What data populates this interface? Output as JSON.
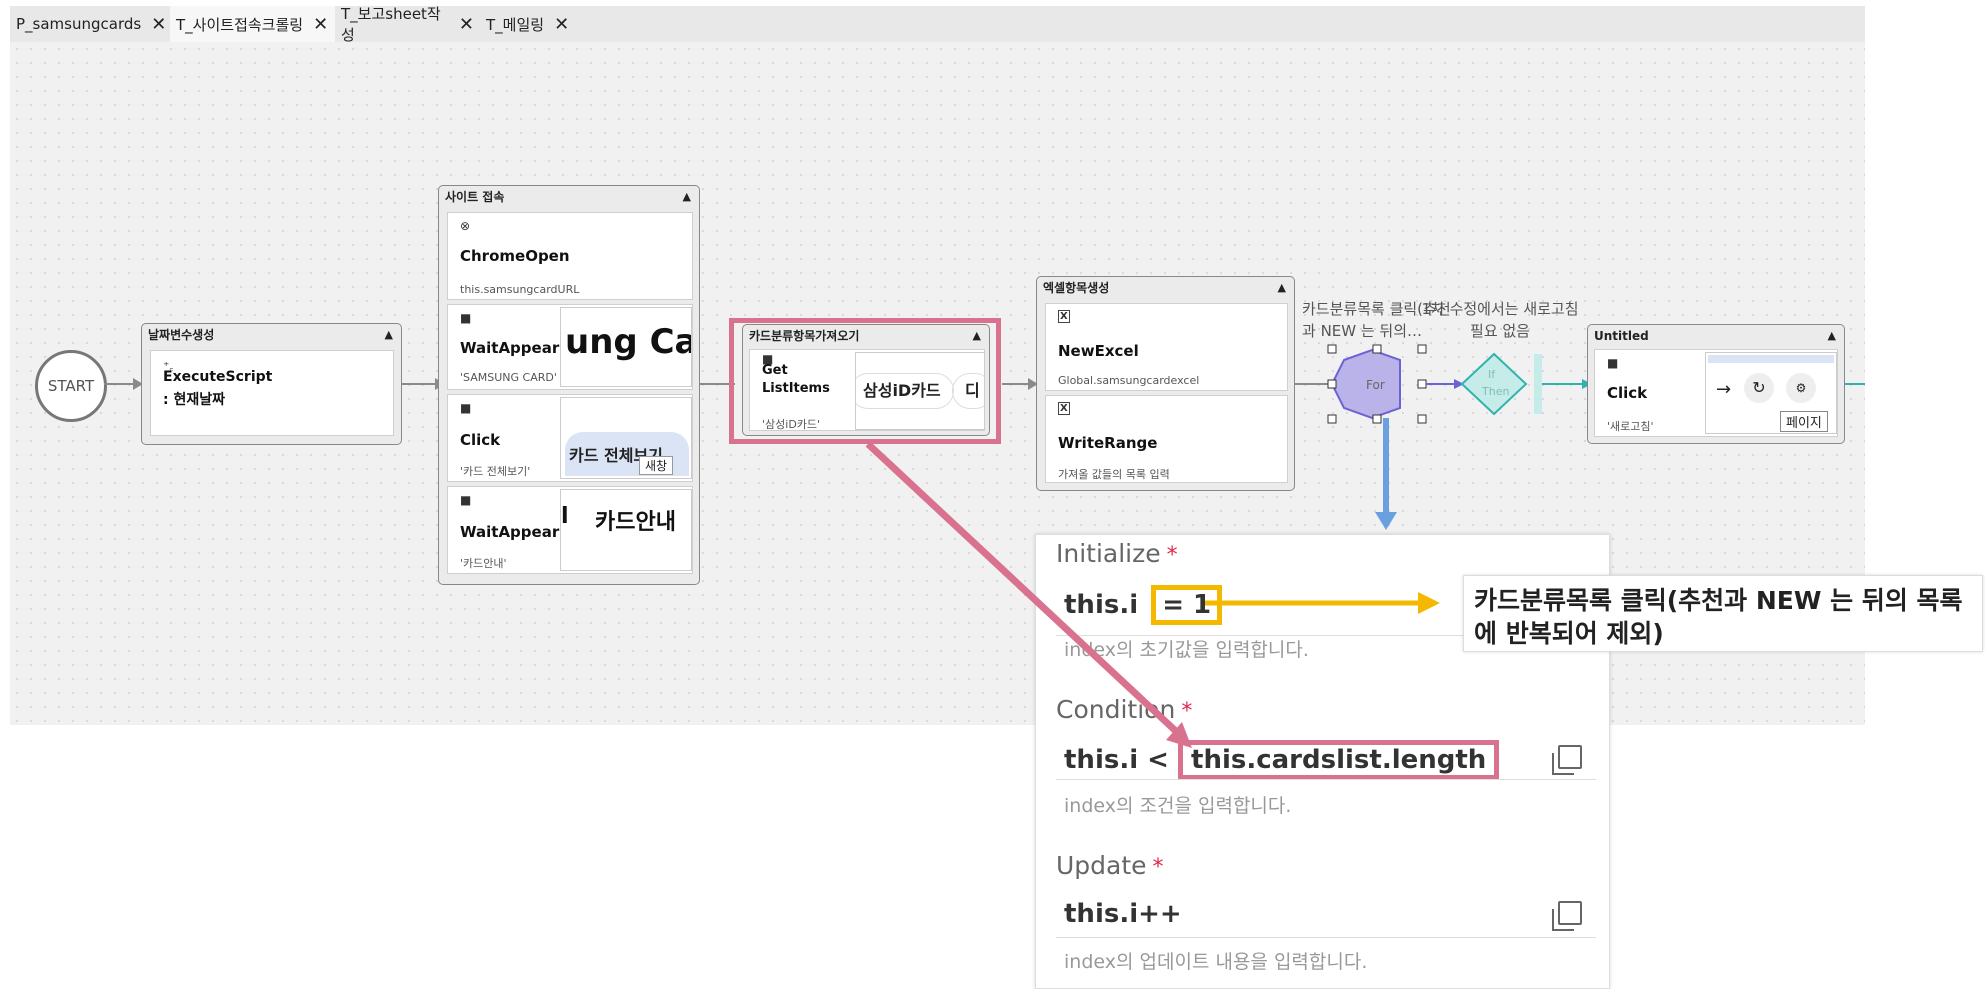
{
  "tabs": [
    {
      "label": "P_samsungcards"
    },
    {
      "label": "T_사이트접속크롤링"
    },
    {
      "label": "T_보고sheet작성"
    },
    {
      "label": "T_메일링"
    }
  ],
  "tab_close": "✕",
  "start": {
    "label": "START"
  },
  "group_date": {
    "title": "날짜변수생성",
    "activity": {
      "icon": "⁺꜀",
      "name": "ExecuteScript",
      "sub": ": 현재날짜"
    }
  },
  "group_site": {
    "title": "사이트 접속",
    "activities": [
      {
        "icon": "⊗",
        "name": "ChromeOpen",
        "sub": "this.samsungcardURL"
      },
      {
        "icon": "■",
        "name": "WaitAppear",
        "sub": "'SAMSUNG CARD'",
        "thumb": "ung Card"
      },
      {
        "icon": "■",
        "name": "Click",
        "sub": "'카드 전체보기'",
        "thumb": "카드 전체보기",
        "thumb2": "새창"
      },
      {
        "icon": "■",
        "name": "WaitAppear",
        "sub": "'카드안내'",
        "thumb_left": "l",
        "thumb": "카드안내"
      }
    ]
  },
  "group_list": {
    "title": "카드분류항목가져오기",
    "activity": {
      "icon": "■",
      "name": "Get ListItems",
      "sub": "'삼성iD카드'",
      "thumb": "삼성iD카드",
      "thumb2": "디"
    }
  },
  "group_excel": {
    "title": "엑셀항목생성",
    "activities": [
      {
        "icon": "X",
        "name": "NewExcel",
        "sub": "Global.samsungcardexcel"
      },
      {
        "icon": "X",
        "name": "WriteRange",
        "sub": "가져올 값들의 목록 입력"
      }
    ]
  },
  "for_node": {
    "label": "For",
    "caption": "카드분류목록 클릭(추천과 NEW 는 뒤의…"
  },
  "if_node": {
    "label_if": "If",
    "label_then": "Then",
    "caption": "1차 수정에서는 새로고침 필요 없음"
  },
  "group_untitled": {
    "title": "Untitled",
    "activity": {
      "icon": "■",
      "name": "Click",
      "sub": "'새로고침'",
      "thumb": "페이지"
    }
  },
  "collapse_symbol": "▲",
  "panel": {
    "initialize": {
      "label": "Initialize",
      "value_prefix": "this.i",
      "value": "= 1",
      "hint": "index의 초기값을 입력합니다."
    },
    "condition": {
      "label": "Condition",
      "value_prefix": "this.i <",
      "value": "this.cardslist.length",
      "hint": "index의 조건을 입력합니다."
    },
    "update": {
      "label": "Update",
      "value": "this.i++",
      "hint": "index의 업데이트 내용을 입력합니다."
    },
    "required_mark": "*"
  },
  "callout": {
    "text": "카드분류목록 클릭(추천과 NEW 는 뒤의 목록에 반복되어 제외)"
  },
  "colors": {
    "pink_highlight": "#d9728f",
    "yellow_highlight": "#f5b800",
    "blue_link": "#6aa0e0",
    "for_fill": "#b9b3ea",
    "if_stroke": "#2fb3ab"
  }
}
